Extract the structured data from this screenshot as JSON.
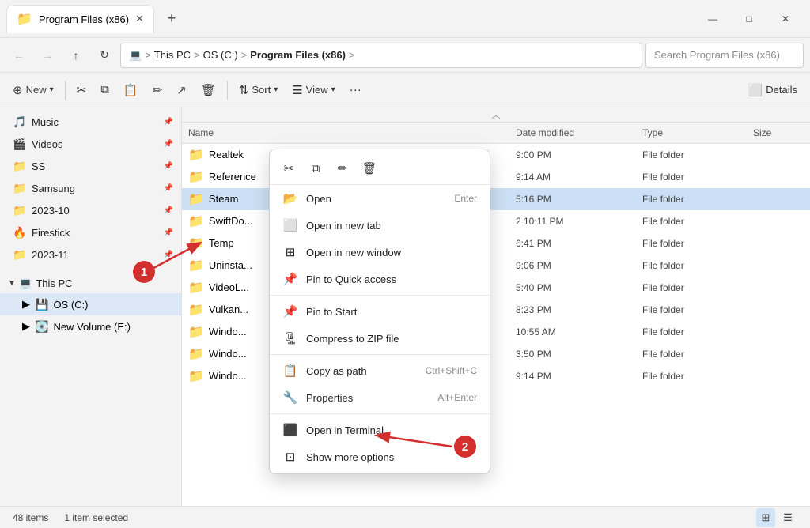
{
  "titlebar": {
    "tab_label": "Program Files (x86)",
    "tab_icon": "📁",
    "new_tab_icon": "+",
    "minimize": "—",
    "maximize": "□",
    "close": "✕"
  },
  "addressbar": {
    "back": "←",
    "forward": "→",
    "up": "↑",
    "refresh": "↻",
    "computer_icon": "💻",
    "this_pc": "This PC",
    "sep1": ">",
    "os_c": "OS (C:)",
    "sep2": ">",
    "program_files": "Program Files (x86)",
    "sep3": ">",
    "search_placeholder": "Search Program Files (x86)"
  },
  "toolbar": {
    "new_label": "New",
    "sort_label": "Sort",
    "view_label": "View",
    "details_label": "Details"
  },
  "sidebar": {
    "items": [
      {
        "icon": "🎵",
        "label": "Music",
        "pinned": true
      },
      {
        "icon": "🎬",
        "label": "Videos",
        "pinned": true
      },
      {
        "icon": "📁",
        "label": "SS",
        "pinned": true
      },
      {
        "icon": "📁",
        "label": "Samsung",
        "pinned": true
      },
      {
        "icon": "📁",
        "label": "2023-10",
        "pinned": true
      },
      {
        "icon": "🔥",
        "label": "Firestick",
        "pinned": true
      },
      {
        "icon": "📁",
        "label": "2023-11",
        "pinned": true
      }
    ],
    "this_pc_label": "This PC",
    "os_c_label": "OS (C:)",
    "new_volume_label": "New Volume (E:)"
  },
  "file_table": {
    "headers": [
      "Name",
      "Date modified",
      "Type",
      "Size"
    ],
    "rows": [
      {
        "name": "Realtek",
        "date": "9:00 PM",
        "type": "File folder",
        "selected": false
      },
      {
        "name": "Reference",
        "date": "9:14 AM",
        "type": "File folder",
        "selected": false
      },
      {
        "name": "Steam",
        "date": "5:16 PM",
        "type": "File folder",
        "selected": true
      },
      {
        "name": "SwiftDo...",
        "date": "2 10:11 PM",
        "type": "File folder",
        "selected": false
      },
      {
        "name": "Temp",
        "date": "6:41 PM",
        "type": "File folder",
        "selected": false
      },
      {
        "name": "Uninsta...",
        "date": "9:06 PM",
        "type": "File folder",
        "selected": false
      },
      {
        "name": "VideoL...",
        "date": "5:40 PM",
        "type": "File folder",
        "selected": false
      },
      {
        "name": "Vulkan...",
        "date": "8:23 PM",
        "type": "File folder",
        "selected": false
      },
      {
        "name": "Windo...",
        "date": "10:55 AM",
        "type": "File folder",
        "selected": false
      },
      {
        "name": "Windo...",
        "date": "3:50 PM",
        "type": "File folder",
        "selected": false
      },
      {
        "name": "Windo...",
        "date": "9:14 PM",
        "type": "File folder",
        "selected": false
      }
    ]
  },
  "context_menu": {
    "toolbar_icons": [
      "✂",
      "⧉",
      "✎",
      "🗑"
    ],
    "items": [
      {
        "icon": "📂",
        "label": "Open",
        "shortcut": "Enter",
        "type": "item"
      },
      {
        "icon": "⬜",
        "label": "Open in new tab",
        "shortcut": "",
        "type": "item"
      },
      {
        "icon": "⊞",
        "label": "Open in new window",
        "shortcut": "",
        "type": "item"
      },
      {
        "icon": "📌",
        "label": "Pin to Quick access",
        "shortcut": "",
        "type": "item"
      },
      {
        "icon": "📌",
        "label": "Pin to Start",
        "shortcut": "",
        "type": "item"
      },
      {
        "icon": "🗜",
        "label": "Compress to ZIP file",
        "shortcut": "",
        "type": "item"
      },
      {
        "icon": "📋",
        "label": "Copy as path",
        "shortcut": "Ctrl+Shift+C",
        "type": "item"
      },
      {
        "icon": "🔧",
        "label": "Properties",
        "shortcut": "Alt+Enter",
        "type": "item"
      },
      {
        "icon": "⬛",
        "label": "Open in Terminal",
        "shortcut": "",
        "type": "item"
      },
      {
        "icon": "⊡",
        "label": "Show more options",
        "shortcut": "",
        "type": "item"
      }
    ]
  },
  "statusbar": {
    "item_count": "48 items",
    "selected": "1 item selected"
  },
  "annotations": {
    "badge1": "1",
    "badge2": "2"
  }
}
